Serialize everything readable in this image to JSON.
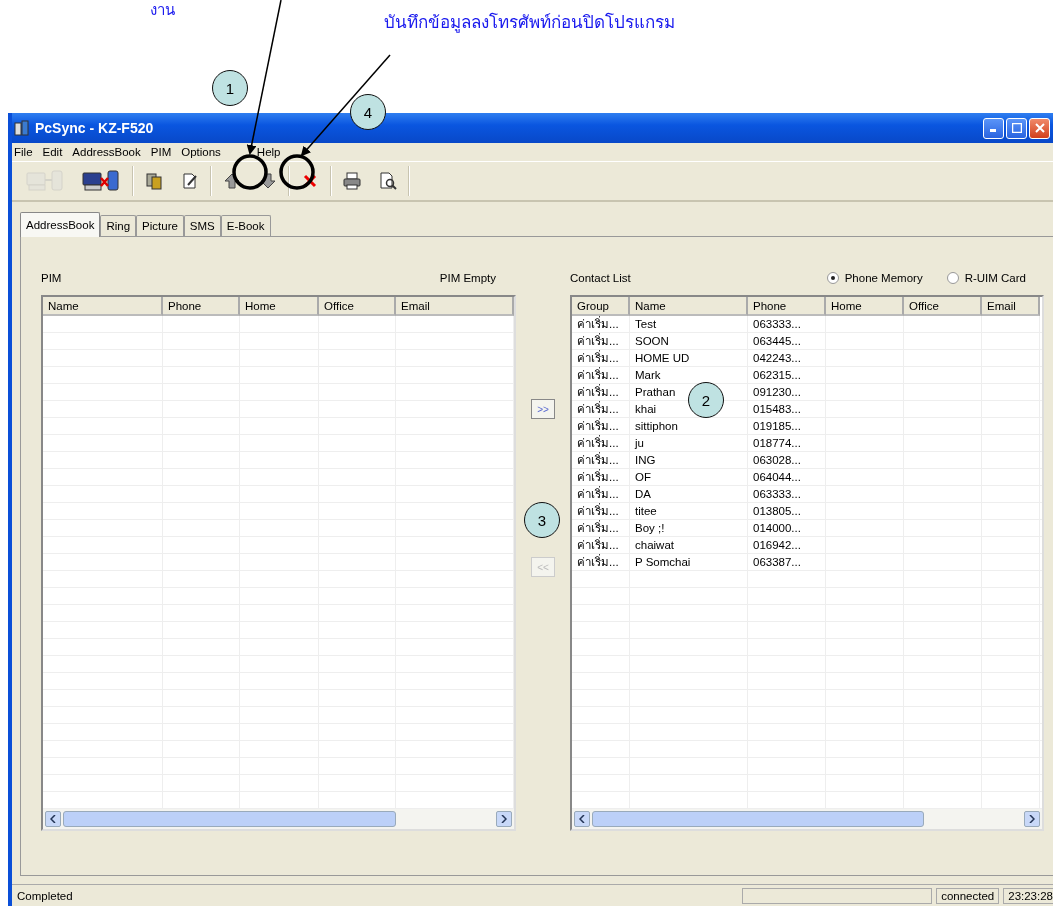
{
  "annotations": {
    "cut_text": "งาน",
    "caption": "บันทึกข้อมูลลงโทรศัพท์ก่อนปิดโปรแกรม",
    "callouts": [
      {
        "label": "1"
      },
      {
        "label": "4"
      },
      {
        "label": "2"
      },
      {
        "label": "3"
      }
    ]
  },
  "window": {
    "title": "PcSync - KZ-F520"
  },
  "menu": [
    "File",
    "Edit",
    "AddressBook",
    "PIM",
    "Options",
    "Help"
  ],
  "toolbar": [
    {
      "kind": "connect",
      "disabled": true
    },
    {
      "kind": "disconnect",
      "disabled": false
    },
    {
      "kind": "sep"
    },
    {
      "kind": "cards",
      "disabled": false
    },
    {
      "kind": "edit",
      "disabled": false
    },
    {
      "kind": "sep"
    },
    {
      "kind": "upload",
      "disabled": false
    },
    {
      "kind": "download",
      "disabled": false
    },
    {
      "kind": "sep"
    },
    {
      "kind": "delete",
      "disabled": false
    },
    {
      "kind": "sep"
    },
    {
      "kind": "print",
      "disabled": false
    },
    {
      "kind": "preview",
      "disabled": false
    },
    {
      "kind": "sep"
    }
  ],
  "tabs": [
    {
      "label": "AddressBook",
      "selected": true
    },
    {
      "label": "Ring",
      "selected": false
    },
    {
      "label": "Picture",
      "selected": false
    },
    {
      "label": "SMS",
      "selected": false
    },
    {
      "label": "E-Book",
      "selected": false
    }
  ],
  "pim": {
    "title": "PIM",
    "status": "PIM Empty",
    "columns": [
      "Name",
      "Phone",
      "Home",
      "Office",
      "Email"
    ]
  },
  "transfer": [
    {
      "label": ">>",
      "disabled": false
    },
    {
      "label": "<<",
      "disabled": true
    }
  ],
  "contacts": {
    "title": "Contact List",
    "sources": [
      {
        "label": "Phone Memory",
        "selected": true
      },
      {
        "label": "R-UIM Card",
        "selected": false
      }
    ],
    "columns": [
      "Group",
      "Name",
      "Phone",
      "Home",
      "Office",
      "Email"
    ],
    "rows": [
      [
        "ค่าเริ่ม...",
        "Test",
        "063333..."
      ],
      [
        "ค่าเริ่ม...",
        "SOON",
        "063445..."
      ],
      [
        "ค่าเริ่ม...",
        "HOME UD",
        "042243..."
      ],
      [
        "ค่าเริ่ม...",
        "Mark",
        "062315..."
      ],
      [
        "ค่าเริ่ม...",
        "Prathan",
        "091230..."
      ],
      [
        "ค่าเริ่ม...",
        "khai",
        "015483..."
      ],
      [
        "ค่าเริ่ม...",
        "sittiphon",
        "019185..."
      ],
      [
        "ค่าเริ่ม...",
        "ju",
        "018774..."
      ],
      [
        "ค่าเริ่ม...",
        "ING",
        "063028..."
      ],
      [
        "ค่าเริ่ม...",
        "OF",
        "064044..."
      ],
      [
        "ค่าเริ่ม...",
        "DA",
        "063333..."
      ],
      [
        "ค่าเริ่ม...",
        "titee",
        "013805..."
      ],
      [
        "ค่าเริ่ม...",
        "Boy ;!",
        "014000..."
      ],
      [
        "ค่าเริ่ม...",
        "chaiwat",
        "016942..."
      ],
      [
        "ค่าเริ่ม...",
        "P Somchai",
        "063387..."
      ]
    ]
  },
  "status_bar": {
    "message": "Completed",
    "connection": "connected",
    "time": "23:23:28"
  }
}
